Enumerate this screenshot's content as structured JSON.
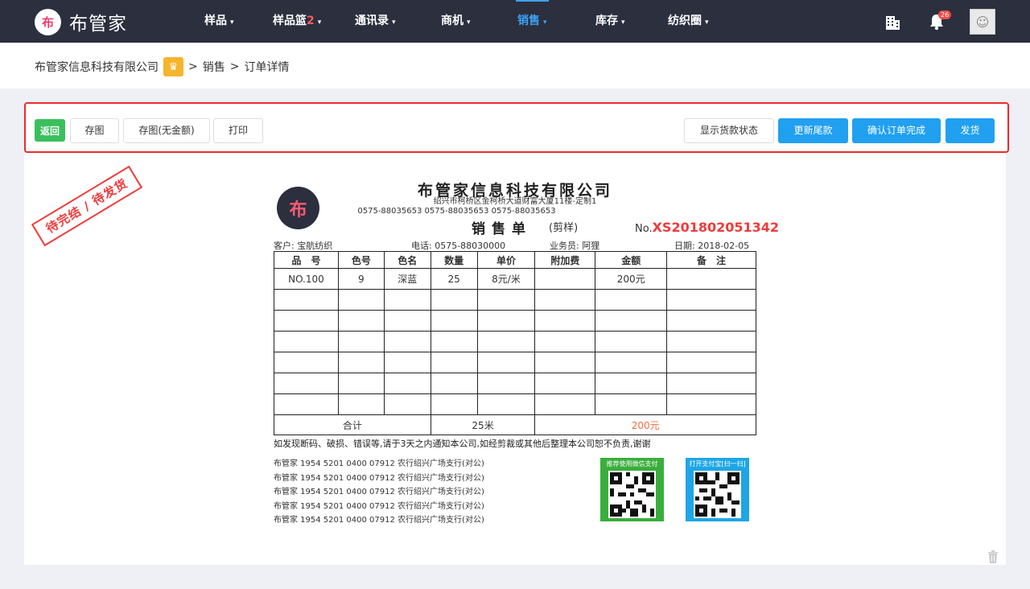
{
  "app": {
    "logo_glyph": "布",
    "name": "布管家",
    "accent_color": "#3da2f5",
    "nav_background": "#2b2f3e"
  },
  "nav": {
    "items": [
      {
        "label": "样品",
        "caret": "▾"
      },
      {
        "label": "样品篮",
        "count": "2",
        "caret": "▾"
      },
      {
        "label": "通讯录",
        "caret": "▾"
      },
      {
        "label": "商机",
        "caret": "▾"
      },
      {
        "label": "销售",
        "caret": "▾",
        "active": true
      },
      {
        "label": "库存",
        "caret": "▾"
      },
      {
        "label": "纺织圈",
        "caret": "▾"
      }
    ],
    "notification_count": "26",
    "icons": [
      "building-icon",
      "bell-icon",
      "avatar"
    ]
  },
  "breadcrumb": {
    "company": "布管家信息科技有限公司",
    "crown_icon": "crown-icon",
    "separator": ">",
    "level1": "销售",
    "level2": "订单详情"
  },
  "toolbar": {
    "back": "返回",
    "save_image": "存图",
    "save_image_no_amount": "存图(无金额)",
    "print": "打印",
    "show_payment_status": "显示货款状态",
    "update_balance": "更新尾款",
    "confirm_complete": "确认订单完成",
    "ship": "发货"
  },
  "order": {
    "status_stamp": "待完结 / 待发货",
    "company_name": "布管家信息科技有限公司",
    "company_logo_glyph": "布",
    "address": "绍兴市柯桥区金柯桥大道财富大厦11楼-定制1",
    "phones": "0575-88035653  0575-88035653  0575-88035653",
    "title": "销售单",
    "subtitle": "(剪样)",
    "no_prefix": "No.",
    "no_value": "XS201802051342",
    "customer": "客户:  宝航纺织",
    "phone": "电话:  0575-88030000",
    "salesperson": "业务员:  阿狸",
    "date": "日期:  2018-02-05",
    "headers": [
      "品　号",
      "色号",
      "色名",
      "数量",
      "单价",
      "附加费",
      "金额",
      "备　注"
    ],
    "rows": [
      [
        "NO.100",
        "9",
        "深蓝",
        "25",
        "8元/米",
        "",
        "200元",
        ""
      ]
    ],
    "empty_rows": 6,
    "total_label": "合计",
    "total_quantity": "25米",
    "total_amount": "200元",
    "notice": "如发现断码、破损、错误等,请于3天之内通知本公司,如经剪裁或其他后整理本公司恕不负责,谢谢",
    "bank_lines": [
      "布管家   1954 5201 0400 07912   农行绍兴广场支行(对公)",
      "布管家   1954 5201 0400 07912   农行绍兴广场支行(对公)",
      "布管家   1954 5201 0400 07912   农行绍兴广场支行(对公)",
      "布管家   1954 5201 0400 07912   农行绍兴广场支行(对公)",
      "布管家   1954 5201 0400 07912   农行绍兴广场支行(对公)"
    ],
    "qr_wechat_caption": "推荐使用微信支付",
    "qr_wechat_color": "#3aae3c",
    "qr_alipay_caption": "打开支付宝[扫一扫]",
    "qr_alipay_color": "#1ea6e6"
  }
}
